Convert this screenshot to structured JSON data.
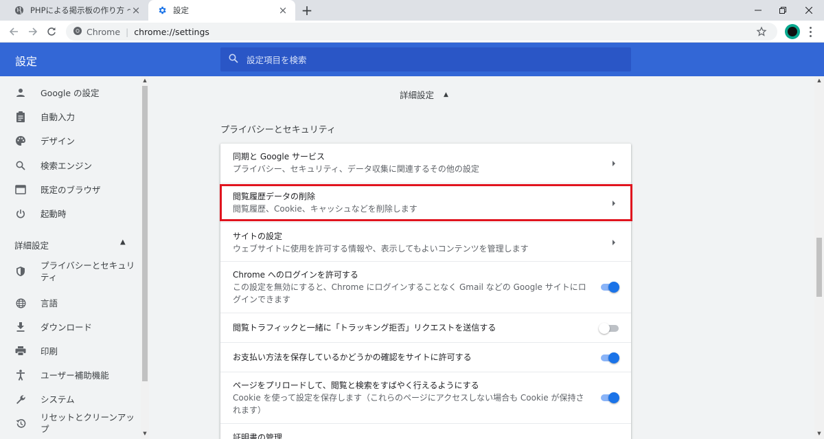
{
  "tabs": [
    {
      "title": "PHPによる掲示板の作り方 ～ここは"
    },
    {
      "title": "設定"
    }
  ],
  "toolbar": {
    "scheme": "Chrome",
    "separator": "|",
    "url": "chrome://settings"
  },
  "header": {
    "title": "設定",
    "search_placeholder": "設定項目を検索"
  },
  "sidebar": {
    "items": [
      {
        "label": "Google の設定",
        "icon": "person-icon"
      },
      {
        "label": "自動入力",
        "icon": "clipboard-icon"
      },
      {
        "label": "デザイン",
        "icon": "palette-icon"
      },
      {
        "label": "検索エンジン",
        "icon": "search-icon"
      },
      {
        "label": "既定のブラウザ",
        "icon": "browser-icon"
      },
      {
        "label": "起動時",
        "icon": "power-icon"
      }
    ],
    "advanced_label": "詳細設定",
    "advanced_items": [
      {
        "label": "プライバシーとセキュリティ",
        "icon": "shield-icon"
      },
      {
        "label": "言語",
        "icon": "globe-icon"
      },
      {
        "label": "ダウンロード",
        "icon": "download-icon"
      },
      {
        "label": "印刷",
        "icon": "printer-icon"
      },
      {
        "label": "ユーザー補助機能",
        "icon": "accessibility-icon"
      },
      {
        "label": "システム",
        "icon": "wrench-icon"
      },
      {
        "label": "リセットとクリーンアップ",
        "icon": "history-icon"
      }
    ]
  },
  "main": {
    "advanced_heading": "詳細設定",
    "section_title": "プライバシーとセキュリティ",
    "rows": [
      {
        "title": "同期と Google サービス",
        "subtitle": "プライバシー、セキュリティ、データ収集に関連するその他の設定"
      },
      {
        "title": "閲覧履歴データの削除",
        "subtitle": "閲覧履歴、Cookie、キャッシュなどを削除します"
      },
      {
        "title": "サイトの設定",
        "subtitle": "ウェブサイトに使用を許可する情報や、表示してもよいコンテンツを管理します"
      },
      {
        "title": "Chrome へのログインを許可する",
        "subtitle": "この設定を無効にすると、Chrome にログインすることなく Gmail などの Google サイトにログインできます",
        "toggle": true
      },
      {
        "title": "閲覧トラフィックと一緒に「トラッキング拒否」リクエストを送信する",
        "toggle": false
      },
      {
        "title": "お支払い方法を保存しているかどうかの確認をサイトに許可する",
        "toggle": true
      },
      {
        "title": "ページをプリロードして、閲覧と検索をすばやく行えるようにする",
        "subtitle": "Cookie を使って設定を保存します（これらのページにアクセスしない場合も Cookie が保持されます）",
        "toggle": true
      },
      {
        "title": "証明書の管理"
      }
    ]
  },
  "colors": {
    "header_blue": "#3367d6",
    "toggle_on": "#1a73e8",
    "highlight_red": "#e0141e"
  }
}
